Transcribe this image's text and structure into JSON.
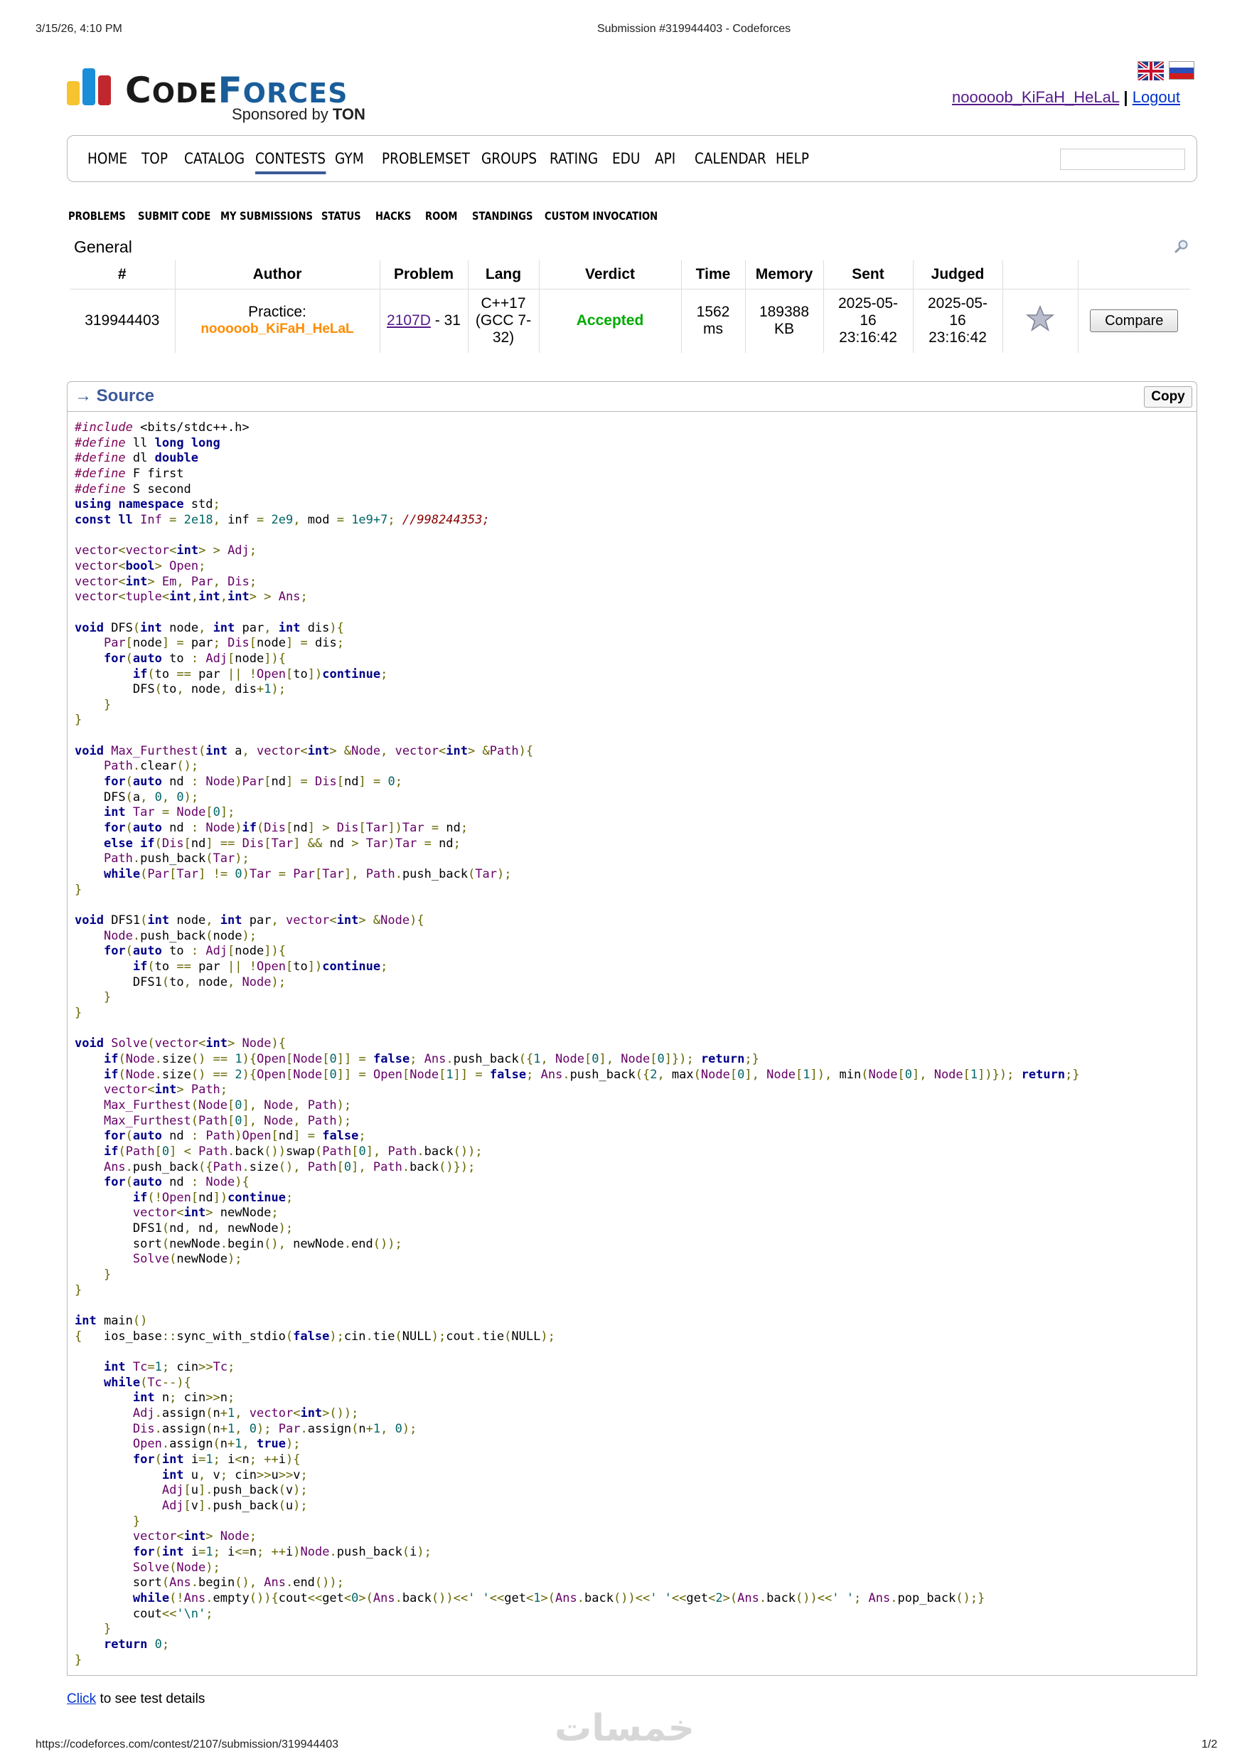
{
  "print_header": {
    "datetime": "3/15/26, 4:10 PM",
    "page_title": "Submission #319944403 - Codeforces"
  },
  "print_footer": {
    "url": "https://codeforces.com/contest/2107/submission/319944403",
    "page": "1/2"
  },
  "logo": {
    "word_a": "C",
    "word_b": "ODE",
    "word_c": "F",
    "word_d": "ORCES",
    "sponsor_text": "Sponsored by",
    "sponsor_name": "TON",
    "bar_colors": [
      "#f6c331",
      "#1a8fd8",
      "#c0282d"
    ]
  },
  "user": {
    "handle": "nooooob_KiFaH_HeLaL",
    "separator": "|",
    "logout": "Logout"
  },
  "main_menu": [
    "HOME",
    "TOP",
    "CATALOG",
    "CONTESTS",
    "GYM",
    "PROBLEMSET",
    "GROUPS",
    "RATING",
    "EDU",
    "API",
    "CALENDAR",
    "HELP"
  ],
  "active_menu": "CONTESTS",
  "sub_menu": [
    "PROBLEMS",
    "SUBMIT CODE",
    "MY SUBMISSIONS",
    "STATUS",
    "HACKS",
    "ROOM",
    "STANDINGS",
    "CUSTOM INVOCATION"
  ],
  "section_title": "General",
  "status_table": {
    "headers": [
      "#",
      "Author",
      "Problem",
      "Lang",
      "Verdict",
      "Time",
      "Memory",
      "Sent",
      "Judged",
      "",
      ""
    ],
    "row": {
      "id": "319944403",
      "author_prefix": "Practice:",
      "author_handle": "nooooob_KiFaH_HeLaL",
      "problem_link": "2107D",
      "problem_rest": "- 31",
      "lang_l1": "C++17",
      "lang_l2": "(GCC 7-",
      "lang_l3": "32)",
      "verdict": "Accepted",
      "time_l1": "1562",
      "time_l2": "ms",
      "mem_l1": "189388",
      "mem_l2": "KB",
      "sent_l1": "2025-05-",
      "sent_l2": "16",
      "sent_l3": "23:16:42",
      "judged_l1": "2025-05-",
      "judged_l2": "16",
      "judged_l3": "23:16:42",
      "compare": "Compare"
    }
  },
  "source": {
    "title": "→ Source",
    "copy": "Copy"
  },
  "code_lines": [
    "#include <bits/stdc++.h>",
    "#define ll long long",
    "#define dl double",
    "#define F first",
    "#define S second",
    "using namespace std;",
    "const ll Inf = 2e18, inf = 2e9, mod = 1e9+7; //998244353;",
    "",
    "vector<vector<int> > Adj;",
    "vector<bool> Open;",
    "vector<int> Em, Par, Dis;",
    "vector<tuple<int,int,int> > Ans;",
    "",
    "void DFS(int node, int par, int dis){",
    "    Par[node] = par; Dis[node] = dis;",
    "    for(auto to : Adj[node]){",
    "        if(to == par || !Open[to])continue;",
    "        DFS(to, node, dis+1);",
    "    }",
    "}",
    "",
    "void Max_Furthest(int a, vector<int> &Node, vector<int> &Path){",
    "    Path.clear();",
    "    for(auto nd : Node)Par[nd] = Dis[nd] = 0;",
    "    DFS(a, 0, 0);",
    "    int Tar = Node[0];",
    "    for(auto nd : Node)if(Dis[nd] > Dis[Tar])Tar = nd;",
    "    else if(Dis[nd] == Dis[Tar] && nd > Tar)Tar = nd;",
    "    Path.push_back(Tar);",
    "    while(Par[Tar] != 0)Tar = Par[Tar], Path.push_back(Tar);",
    "}",
    "",
    "void DFS1(int node, int par, vector<int> &Node){",
    "    Node.push_back(node);",
    "    for(auto to : Adj[node]){",
    "        if(to == par || !Open[to])continue;",
    "        DFS1(to, node, Node);",
    "    }",
    "}",
    "",
    "void Solve(vector<int> Node){",
    "    if(Node.size() == 1){Open[Node[0]] = false; Ans.push_back({1, Node[0], Node[0]}); return;}",
    "    if(Node.size() == 2){Open[Node[0]] = Open[Node[1]] = false; Ans.push_back({2, max(Node[0], Node[1]), min(Node[0], Node[1])}); return;}",
    "    vector<int> Path;",
    "    Max_Furthest(Node[0], Node, Path);",
    "    Max_Furthest(Path[0], Node, Path);",
    "    for(auto nd : Path)Open[nd] = false;",
    "    if(Path[0] < Path.back())swap(Path[0], Path.back());",
    "    Ans.push_back({Path.size(), Path[0], Path.back()});",
    "    for(auto nd : Node){",
    "        if(!Open[nd])continue;",
    "        vector<int> newNode;",
    "        DFS1(nd, nd, newNode);",
    "        sort(newNode.begin(), newNode.end());",
    "        Solve(newNode);",
    "    }",
    "}",
    "",
    "int main()",
    "{   ios_base::sync_with_stdio(false);cin.tie(NULL);cout.tie(NULL);",
    "",
    "    int Tc=1; cin>>Tc;",
    "    while(Tc--){",
    "        int n; cin>>n;",
    "        Adj.assign(n+1, vector<int>());",
    "        Dis.assign(n+1, 0); Par.assign(n+1, 0);",
    "        Open.assign(n+1, true);",
    "        for(int i=1; i<n; ++i){",
    "            int u, v; cin>>u>>v;",
    "            Adj[u].push_back(v);",
    "            Adj[v].push_back(u);",
    "        }",
    "        vector<int> Node;",
    "        for(int i=1; i<=n; ++i)Node.push_back(i);",
    "        Solve(Node);",
    "        sort(Ans.begin(), Ans.end());",
    "        while(!Ans.empty()){cout<<get<0>(Ans.back())<<' '<<get<1>(Ans.back())<<' '<<get<2>(Ans.back())<<' '; Ans.pop_back();}",
    "        cout<<'\\n';",
    "    }",
    "    return 0;",
    "}"
  ],
  "footer_link": {
    "link": "Click",
    "rest": "to see test details"
  },
  "watermark": "خمسات"
}
